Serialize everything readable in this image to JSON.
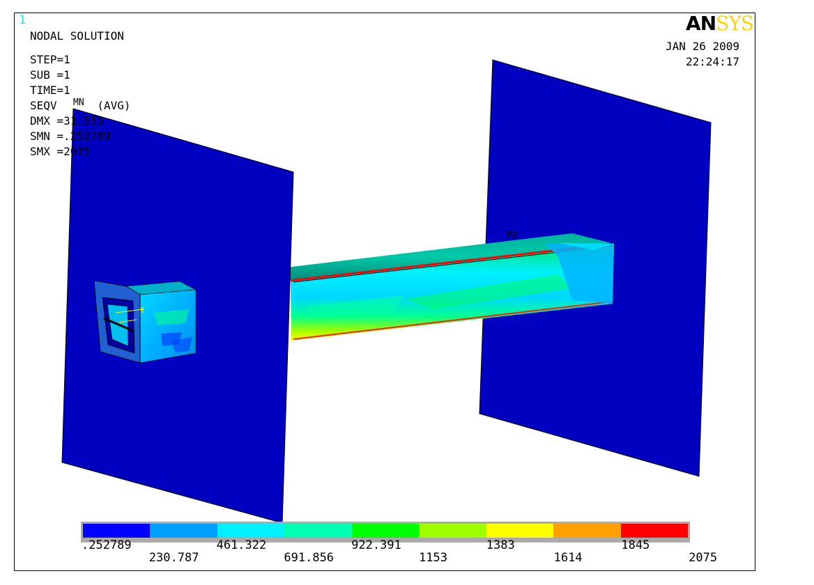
{
  "window_number": "1",
  "logo": {
    "an": "AN",
    "sys": "SYS"
  },
  "datetime": {
    "date": "JAN 26 2009",
    "time": "22:24:17"
  },
  "info": {
    "title": "NODAL SOLUTION",
    "step": "STEP=1",
    "sub": "SUB =1",
    "time": "TIME=1",
    "seqv": "SEQV      (AVG)",
    "dmx": "DMX =31.555",
    "smn": "SMN =.252789",
    "smx": "SMX =2075"
  },
  "markers": {
    "mn": "MN",
    "mx": "MX"
  },
  "legend": {
    "colors": [
      "#0000ff",
      "#00a0ff",
      "#00f0ff",
      "#00ffb0",
      "#00ff00",
      "#a0ff00",
      "#ffff00",
      "#ffa000",
      "#ff0000"
    ],
    "top_labels": [
      ".252789",
      "461.322",
      "922.391",
      "1383",
      "1845"
    ],
    "bottom_labels": [
      "230.787",
      "691.856",
      "1153",
      "1614",
      "2075"
    ]
  }
}
